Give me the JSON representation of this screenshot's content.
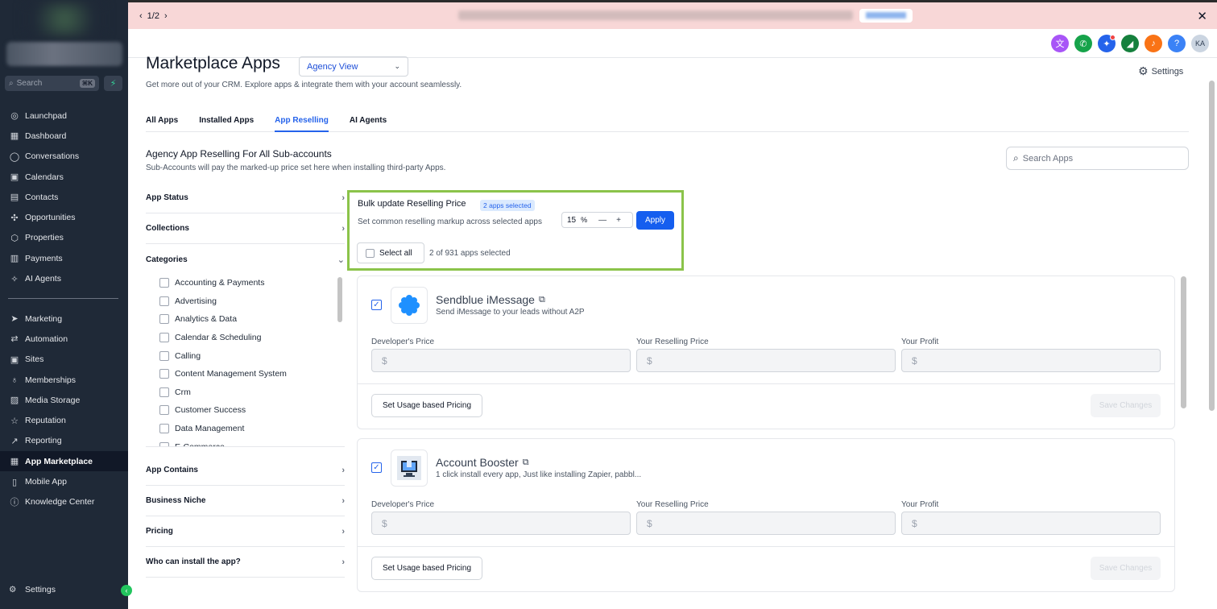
{
  "banner": {
    "pager": "1/2",
    "prev_icon": "chevron-left-icon",
    "next_icon": "chevron-right-icon",
    "close_icon": "close-icon"
  },
  "sidebar": {
    "search_placeholder": "Search",
    "search_shortcut": "⌘K",
    "items_top": [
      {
        "label": "Launchpad",
        "icon": "rocket-icon"
      },
      {
        "label": "Dashboard",
        "icon": "dashboard-icon"
      },
      {
        "label": "Conversations",
        "icon": "chat-icon"
      },
      {
        "label": "Calendars",
        "icon": "calendar-icon"
      },
      {
        "label": "Contacts",
        "icon": "contacts-icon"
      },
      {
        "label": "Opportunities",
        "icon": "opportunities-icon"
      },
      {
        "label": "Properties",
        "icon": "box-icon"
      },
      {
        "label": "Payments",
        "icon": "payments-icon"
      },
      {
        "label": "AI Agents",
        "icon": "sparkle-icon"
      }
    ],
    "items_bottom": [
      {
        "label": "Marketing",
        "icon": "send-icon"
      },
      {
        "label": "Automation",
        "icon": "automation-icon"
      },
      {
        "label": "Sites",
        "icon": "sites-icon"
      },
      {
        "label": "Memberships",
        "icon": "memberships-icon"
      },
      {
        "label": "Media Storage",
        "icon": "image-icon"
      },
      {
        "label": "Reputation",
        "icon": "star-icon"
      },
      {
        "label": "Reporting",
        "icon": "chart-icon"
      },
      {
        "label": "App Marketplace",
        "icon": "grid-icon"
      },
      {
        "label": "Mobile App",
        "icon": "mobile-icon"
      },
      {
        "label": "Knowledge Center",
        "icon": "info-icon"
      }
    ],
    "settings_label": "Settings"
  },
  "header": {
    "avatar_initials": "KA",
    "icons": [
      {
        "name": "translate-icon",
        "color": "#a855f7",
        "glyph": "文"
      },
      {
        "name": "phone-icon",
        "color": "#16a34a",
        "glyph": "✆"
      },
      {
        "name": "magic-icon",
        "color": "#2563eb",
        "glyph": "✦"
      },
      {
        "name": "megaphone-icon",
        "color": "#15803d",
        "glyph": "◢"
      },
      {
        "name": "bell-icon",
        "color": "#f97316",
        "glyph": "♪"
      },
      {
        "name": "help-icon",
        "color": "#3b82f6",
        "glyph": "?"
      }
    ]
  },
  "main": {
    "title": "Marketplace Apps",
    "view_select": "Agency View",
    "subtitle": "Get more out of your CRM. Explore apps & integrate them with your account seamlessly.",
    "settings_label": "Settings",
    "tabs": [
      {
        "label": "All Apps",
        "active": false
      },
      {
        "label": "Installed Apps",
        "active": false
      },
      {
        "label": "App Reselling",
        "active": true
      },
      {
        "label": "AI Agents",
        "active": false
      }
    ],
    "section_title": "Agency App Reselling For All Sub-accounts",
    "section_sub": "Sub-Accounts will pay the marked-up price set here when installing third-party Apps.",
    "search_placeholder": "Search Apps"
  },
  "filters": {
    "app_status": "App Status",
    "collections": "Collections",
    "categories": "Categories",
    "category_items": [
      "Accounting & Payments",
      "Advertising",
      "Analytics & Data",
      "Calendar & Scheduling",
      "Calling",
      "Content Management System",
      "Crm",
      "Customer Success",
      "Data Management",
      "E-Commerce"
    ],
    "app_contains": "App Contains",
    "business_niche": "Business Niche",
    "pricing": "Pricing",
    "who_can_install": "Who can install the app?"
  },
  "bulk": {
    "title": "Bulk update Reselling Price",
    "badge": "2 apps selected",
    "subtitle": "Set common reselling markup across selected apps",
    "markup_value": "15",
    "markup_unit": "%",
    "apply_label": "Apply",
    "select_all_label": "Select all",
    "selected_count": "2 of 931 apps selected"
  },
  "apps": [
    {
      "name": "Sendblue iMessage",
      "description": "Send iMessage to your leads without A2P",
      "checked": true,
      "logo_icon": "sendblue-logo-icon"
    },
    {
      "name": "Account Booster",
      "description": "1 click install every app, Just like installing Zapier, pabbl...",
      "checked": true,
      "logo_icon": "account-booster-logo-icon"
    }
  ],
  "card_labels": {
    "developer_price": "Developer's Price",
    "reselling_price": "Your Reselling Price",
    "profit": "Your Profit",
    "currency": "$",
    "usage_button": "Set Usage based Pricing",
    "save_button": "Save Changes"
  }
}
